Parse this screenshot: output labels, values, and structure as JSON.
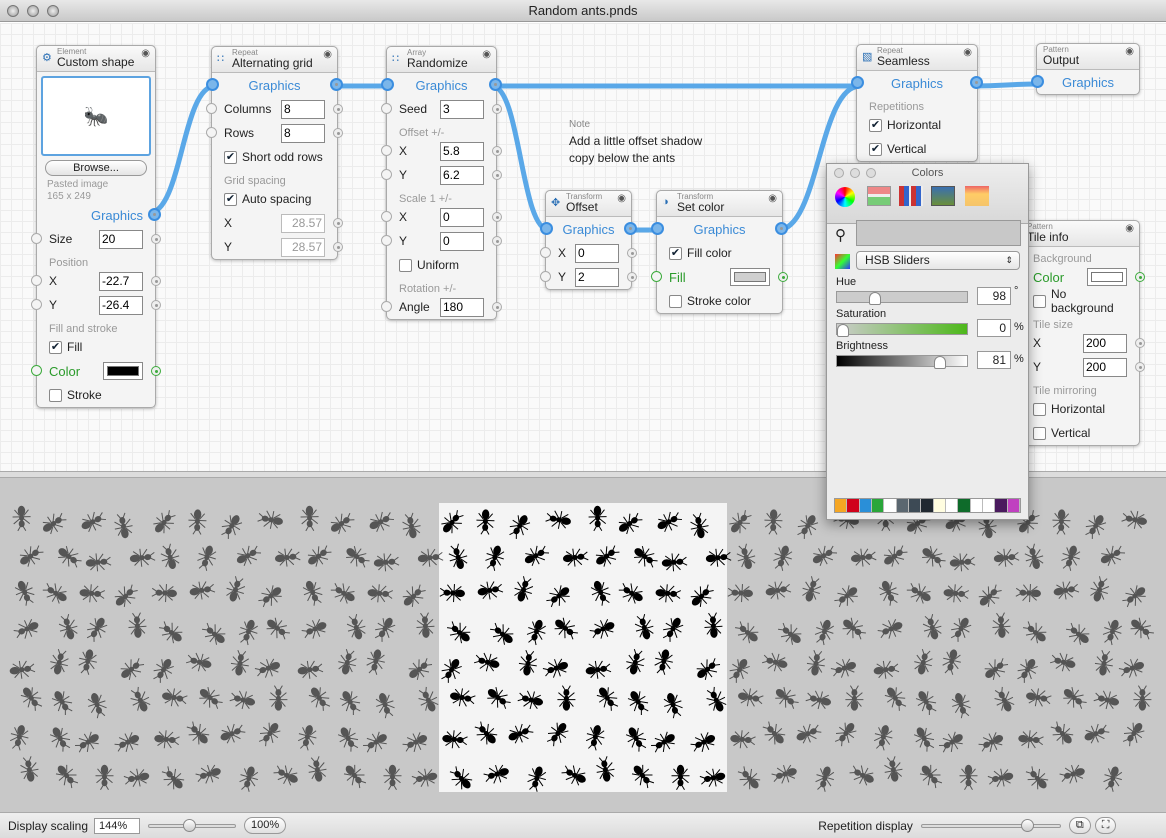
{
  "window": {
    "title": "Random ants.pnds"
  },
  "nodes": [
    {
      "id": "custom",
      "category": "Element",
      "title": "Custom shape",
      "icon": "gear-icon",
      "rows": [
        {
          "kind": "image",
          "glyph": "ant"
        },
        {
          "kind": "button",
          "label": "Browse..."
        },
        {
          "kind": "info",
          "label": "Pasted image"
        },
        {
          "kind": "info",
          "label": "165 x 249"
        },
        {
          "kind": "output",
          "label": "Graphics",
          "align": "right"
        },
        {
          "kind": "field",
          "label": "Size",
          "value": "20"
        },
        {
          "kind": "section",
          "label": "Position"
        },
        {
          "kind": "field",
          "label": "X",
          "value": "-22.7"
        },
        {
          "kind": "field",
          "label": "Y",
          "value": "-26.4"
        },
        {
          "kind": "section",
          "label": "Fill and stroke"
        },
        {
          "kind": "check",
          "label": "Fill",
          "checked": true
        },
        {
          "kind": "color",
          "label": "Color",
          "color": "#000000"
        },
        {
          "kind": "check",
          "label": "Stroke",
          "checked": false
        }
      ]
    },
    {
      "id": "grid",
      "category": "Repeat",
      "title": "Alternating grid",
      "icon": "grid-icon",
      "rows": [
        {
          "kind": "output",
          "label": "Graphics",
          "in": true
        },
        {
          "kind": "field",
          "label": "Columns",
          "value": "8",
          "in": true
        },
        {
          "kind": "field",
          "label": "Rows",
          "value": "8",
          "in": true
        },
        {
          "kind": "check",
          "label": "Short odd rows",
          "checked": true
        },
        {
          "kind": "section",
          "label": "Grid spacing"
        },
        {
          "kind": "check",
          "label": "Auto spacing",
          "checked": true
        },
        {
          "kind": "field",
          "label": "X",
          "value": "28.57",
          "disabled": true
        },
        {
          "kind": "field",
          "label": "Y",
          "value": "28.57",
          "disabled": true
        }
      ]
    },
    {
      "id": "rand",
      "category": "Array",
      "title": "Randomize",
      "icon": "array-icon",
      "rows": [
        {
          "kind": "output",
          "label": "Graphics",
          "in": true
        },
        {
          "kind": "field",
          "label": "Seed",
          "value": "3",
          "in": true
        },
        {
          "kind": "section",
          "label": "Offset +/-"
        },
        {
          "kind": "field",
          "label": "X",
          "value": "5.8",
          "in": true
        },
        {
          "kind": "field",
          "label": "Y",
          "value": "6.2",
          "in": true
        },
        {
          "kind": "section",
          "label": "Scale 1 +/-"
        },
        {
          "kind": "field",
          "label": "X",
          "value": "0",
          "in": true
        },
        {
          "kind": "field",
          "label": "Y",
          "value": "0",
          "in": true
        },
        {
          "kind": "check",
          "label": "Uniform",
          "checked": false
        },
        {
          "kind": "section",
          "label": "Rotation +/-"
        },
        {
          "kind": "field",
          "label": "Angle",
          "value": "180",
          "in": true
        }
      ]
    },
    {
      "id": "offset",
      "category": "Transform",
      "title": "Offset",
      "icon": "move-icon",
      "rows": [
        {
          "kind": "output",
          "label": "Graphics",
          "in": true
        },
        {
          "kind": "field",
          "label": "X",
          "value": "0",
          "in": true
        },
        {
          "kind": "field",
          "label": "Y",
          "value": "2",
          "in": true
        }
      ]
    },
    {
      "id": "setcolor",
      "category": "Transform",
      "title": "Set color",
      "icon": "color-circle-icon",
      "rows": [
        {
          "kind": "output",
          "label": "Graphics",
          "in": true
        },
        {
          "kind": "check",
          "label": "Fill color",
          "checked": true
        },
        {
          "kind": "color",
          "label": "Fill",
          "color": "#cfcfcf",
          "in": true
        },
        {
          "kind": "check",
          "label": "Stroke color",
          "checked": false
        }
      ]
    },
    {
      "id": "seamless",
      "category": "Repeat",
      "title": "Seamless",
      "icon": "tile-icon",
      "rows": [
        {
          "kind": "output",
          "label": "Graphics",
          "in": true
        },
        {
          "kind": "section",
          "label": "Repetitions"
        },
        {
          "kind": "check",
          "label": "Horizontal",
          "checked": true
        },
        {
          "kind": "check",
          "label": "Vertical",
          "checked": true
        }
      ]
    },
    {
      "id": "output",
      "category": "Pattern",
      "title": "Output",
      "rows": [
        {
          "kind": "output",
          "label": "Graphics",
          "in": true,
          "noout": true
        }
      ]
    },
    {
      "id": "tile",
      "category": "Pattern",
      "title": "Tile info",
      "rows": [
        {
          "kind": "section",
          "label": "Background"
        },
        {
          "kind": "color",
          "label": "Color",
          "color": "#ffffff"
        },
        {
          "kind": "check",
          "label": "No background",
          "checked": false
        },
        {
          "kind": "section",
          "label": "Tile size"
        },
        {
          "kind": "field",
          "label": "X",
          "value": "200"
        },
        {
          "kind": "field",
          "label": "Y",
          "value": "200"
        },
        {
          "kind": "section",
          "label": "Tile mirroring"
        },
        {
          "kind": "check",
          "label": "Horizontal",
          "checked": false
        },
        {
          "kind": "check",
          "label": "Vertical",
          "checked": false
        }
      ]
    }
  ],
  "note": {
    "title": "Note",
    "text1": "Add a little offset shadow",
    "text2": "copy below the ants"
  },
  "colors_panel": {
    "title": "Colors",
    "mode": "HSB Sliders",
    "hue": {
      "label": "Hue",
      "value": "98",
      "unit": "°",
      "level": 0.27
    },
    "saturation": {
      "label": "Saturation",
      "value": "0",
      "unit": "%",
      "level": 0
    },
    "brightness": {
      "label": "Brightness",
      "value": "81",
      "unit": "%",
      "level": 0.81
    },
    "swatches": [
      "#f5a623",
      "#d0021b",
      "#2a8fd8",
      "#2aa63a",
      "#ffffff",
      "#5b6770",
      "#3d4a55",
      "#202830",
      "#fffde0",
      "#ffffff",
      "#0e6b2a",
      "#ffffff",
      "#ffffff",
      "#4a1a5e",
      "#c040c0"
    ]
  },
  "wire_color": "#5aa8e8",
  "bottom": {
    "display_scaling_label": "Display scaling",
    "display_scaling_value": "144%",
    "reset_label": "100%",
    "repetition_label": "Repetition display",
    "display_scaling_level": 0.45,
    "repetition_level": 0.78
  }
}
